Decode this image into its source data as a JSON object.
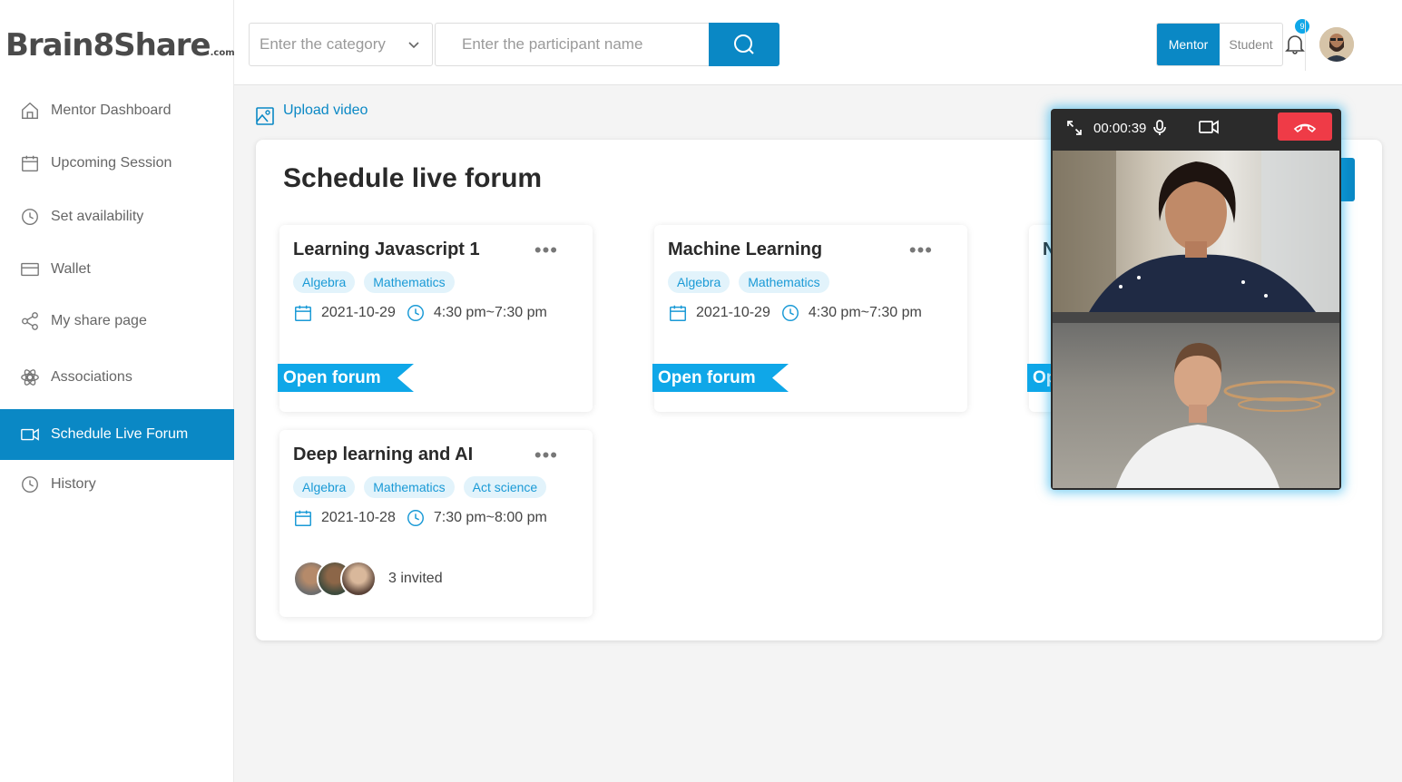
{
  "brand": {
    "name": "Brain8Share",
    "suffix": ".com"
  },
  "sidebar": {
    "items": [
      {
        "label": "Mentor Dashboard",
        "icon": "home-icon",
        "active": false
      },
      {
        "label": "Upcoming Session",
        "icon": "calendar-icon",
        "active": false
      },
      {
        "label": "Set availability",
        "icon": "clock-icon",
        "active": false
      },
      {
        "label": "Wallet",
        "icon": "wallet-icon",
        "active": false
      },
      {
        "label": "My share page",
        "icon": "share-icon",
        "active": false
      },
      {
        "label": "Associations",
        "icon": "associations-icon",
        "active": false
      },
      {
        "label": "Schedule Live Forum",
        "icon": "video-icon",
        "active": true
      },
      {
        "label": "History",
        "icon": "history-icon",
        "active": false
      }
    ]
  },
  "header": {
    "category_placeholder": "Enter the category",
    "participant_placeholder": "Enter the participant name",
    "roles": {
      "mentor": "Mentor",
      "student": "Student",
      "selected": "Mentor"
    },
    "notifications": "9"
  },
  "upload": {
    "label": "Upload video"
  },
  "main": {
    "title": "Schedule live forum",
    "forums": [
      {
        "title": "Learning Javascript 1",
        "tags": [
          "Algebra",
          "Mathematics"
        ],
        "date": "2021-10-29",
        "time": "4:30 pm~7:30 pm",
        "action": "Open forum"
      },
      {
        "title": "Machine Learning",
        "tags": [
          "Algebra",
          "Mathematics"
        ],
        "date": "2021-10-29",
        "time": "4:30 pm~7:30 pm",
        "action": "Open forum"
      },
      {
        "title": "N",
        "tags": [],
        "date": "",
        "time": "",
        "action": "Op"
      },
      {
        "title": "Deep learning and AI",
        "tags": [
          "Algebra",
          "Mathematics",
          "Act science"
        ],
        "date": "2021-10-28",
        "time": "7:30 pm~8:00 pm",
        "invited": "3 invited"
      }
    ]
  },
  "call": {
    "timer": "00:00:39"
  },
  "colors": {
    "primary": "#0a88c5",
    "ribbon": "#0fa7e8",
    "tag_bg": "#e2f3fb",
    "hangup": "#ef3b47"
  }
}
